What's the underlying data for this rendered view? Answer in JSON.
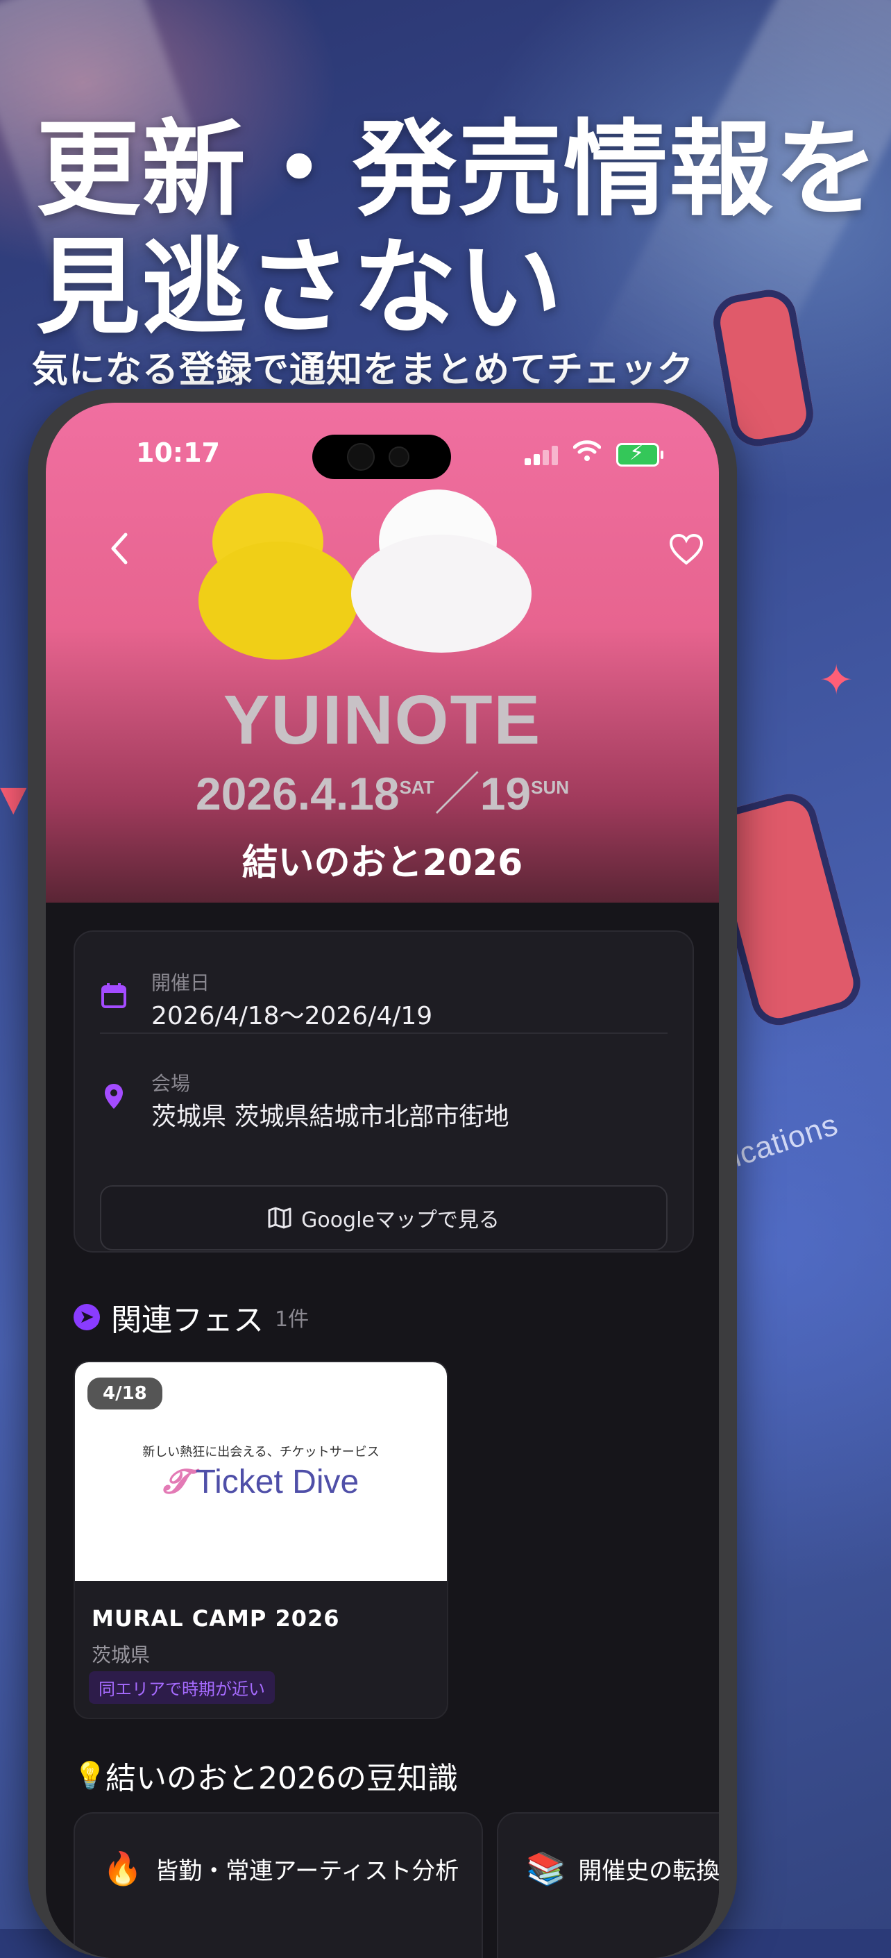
{
  "promo": {
    "headline_line1": "更新・発売情報を",
    "headline_line2": "見逃さない",
    "subheadline": "気になる登録で通知をまとめてチェック",
    "bg_text": "fications"
  },
  "status_bar": {
    "time": "10:17"
  },
  "nav": {
    "back_icon": "chevron-left-icon",
    "favorite_icon": "heart-icon"
  },
  "event": {
    "logo_word": "YUINOTE",
    "logo_dates": "2026.4.18",
    "logo_sat": "SAT",
    "logo_sep": "／",
    "logo_day2": "19",
    "logo_sun": "SUN",
    "title": "結いのおと2026",
    "date_label": "開催日",
    "date_value": "2026/4/18〜2026/4/19",
    "venue_label": "会場",
    "venue_value": "茨城県 茨城県結城市北部市街地",
    "map_button": "Googleマップで見る"
  },
  "related": {
    "heading": "関連フェス",
    "count": "1件",
    "items": [
      {
        "date_chip": "4/18",
        "image_caption": "新しい熱狂に出会える、チケットサービス",
        "image_logo": "Ticket Dive",
        "name": "MURAL CAMP 2026",
        "prefecture": "茨城県",
        "tag": "同エリアで時期が近い"
      }
    ]
  },
  "trivia": {
    "heading": "結いのおと2026の豆知識",
    "cards": [
      {
        "emoji": "🔥",
        "title": "皆勤・常連アーティスト分析"
      },
      {
        "emoji": "📚",
        "title": "開催史の転換"
      }
    ]
  },
  "colors": {
    "accent": "#a44cff",
    "hero_pink": "#f06fa0",
    "background": "#16151a"
  }
}
